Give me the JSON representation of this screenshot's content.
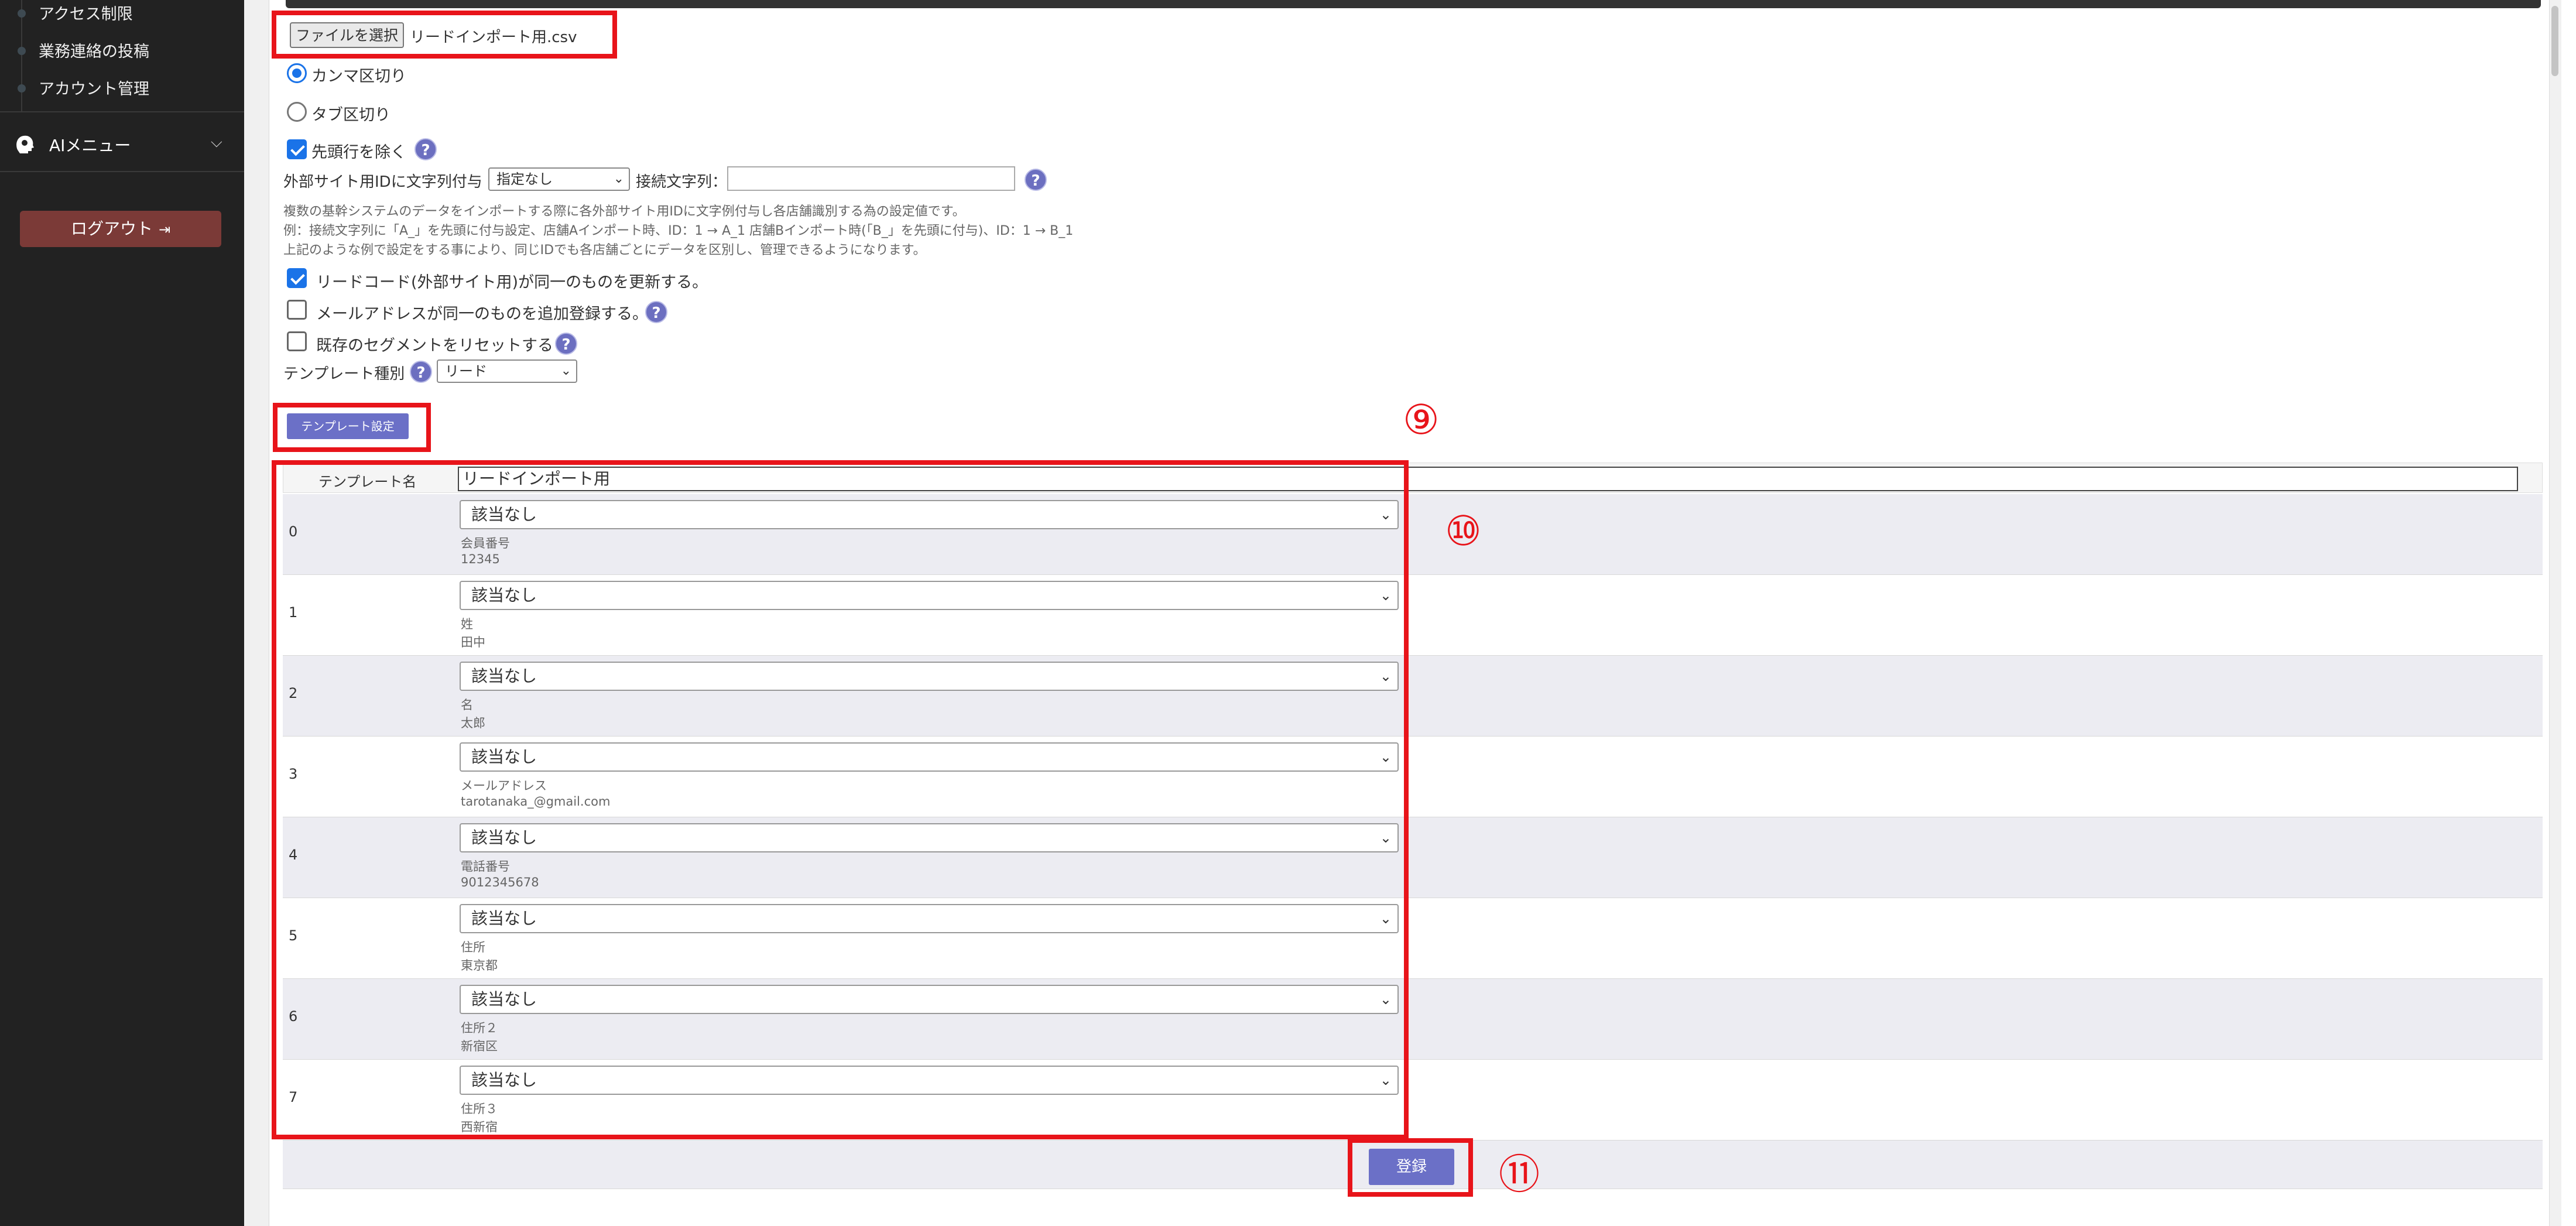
{
  "sidebar": {
    "items": [
      {
        "label": "アクセス制限"
      },
      {
        "label": "業務連絡の投稿"
      },
      {
        "label": "アカウント管理"
      }
    ],
    "ai_menu": {
      "label": "AIメニュー",
      "icon": "ai-head-icon"
    },
    "logout": {
      "label": "ログアウト",
      "icon": "sign-out-icon"
    }
  },
  "import": {
    "file_button": "ファイルを選択",
    "file_name": "リードインポート用.csv",
    "delimiter": {
      "comma": "カンマ区切り",
      "tab": "タブ区切り",
      "selected": "comma"
    },
    "skip_header": {
      "label": "先頭行を除く",
      "checked": true
    },
    "external_id": {
      "label": "外部サイト用IDに文字列付与",
      "select_value": "指定なし",
      "connector_label": "接続文字列：",
      "connector_value": ""
    },
    "notes": [
      "複数の基幹システムのデータをインポートする際に各外部サイト用IDに文字例付与し各店舗識別する為の設定値です。",
      "例：接続文字列に「A_」を先頭に付与設定、店舗Aインポート時、ID：1 → A_1 店舗Bインポート時(「B_」を先頭に付与)、ID：1 → B_1",
      "上記のような例で設定をする事により、同じIDでも各店舗ごとにデータを区別し、管理できるようになります。"
    ],
    "options": [
      {
        "label": "リードコード(外部サイト用)が同一のものを更新する。",
        "checked": true
      },
      {
        "label": "メールアドレスが同一のものを追加登録する。",
        "checked": false
      },
      {
        "label": "既存のセグメントをリセットする",
        "checked": false
      }
    ],
    "template_type": {
      "label": "テンプレート種別",
      "value": "リード"
    },
    "template_settings_button": "テンプレート設定"
  },
  "template": {
    "name_label": "テンプレート名",
    "name_value": "リードインポート用",
    "rows": [
      {
        "index": "0",
        "select": "該当なし",
        "field": "会員番号",
        "sample": "12345"
      },
      {
        "index": "1",
        "select": "該当なし",
        "field": "姓",
        "sample": "田中"
      },
      {
        "index": "2",
        "select": "該当なし",
        "field": "名",
        "sample": "太郎"
      },
      {
        "index": "3",
        "select": "該当なし",
        "field": "メールアドレス",
        "sample": "tarotanaka_@gmail.com"
      },
      {
        "index": "4",
        "select": "該当なし",
        "field": "電話番号",
        "sample": "9012345678"
      },
      {
        "index": "5",
        "select": "該当なし",
        "field": "住所",
        "sample": "東京都"
      },
      {
        "index": "6",
        "select": "該当なし",
        "field": "住所２",
        "sample": "新宿区"
      },
      {
        "index": "7",
        "select": "該当なし",
        "field": "住所３",
        "sample": "西新宿"
      }
    ],
    "submit_button": "登録"
  },
  "annotations": {
    "n9": "⑨",
    "n10": "⑩",
    "n11": "⑪"
  },
  "colors": {
    "sidebar_bg": "#222222",
    "logout_bg": "#7b3a37",
    "accent_button": "#6b70c7",
    "annotation_red": "#e8141a",
    "check_blue": "#1a73e8"
  }
}
